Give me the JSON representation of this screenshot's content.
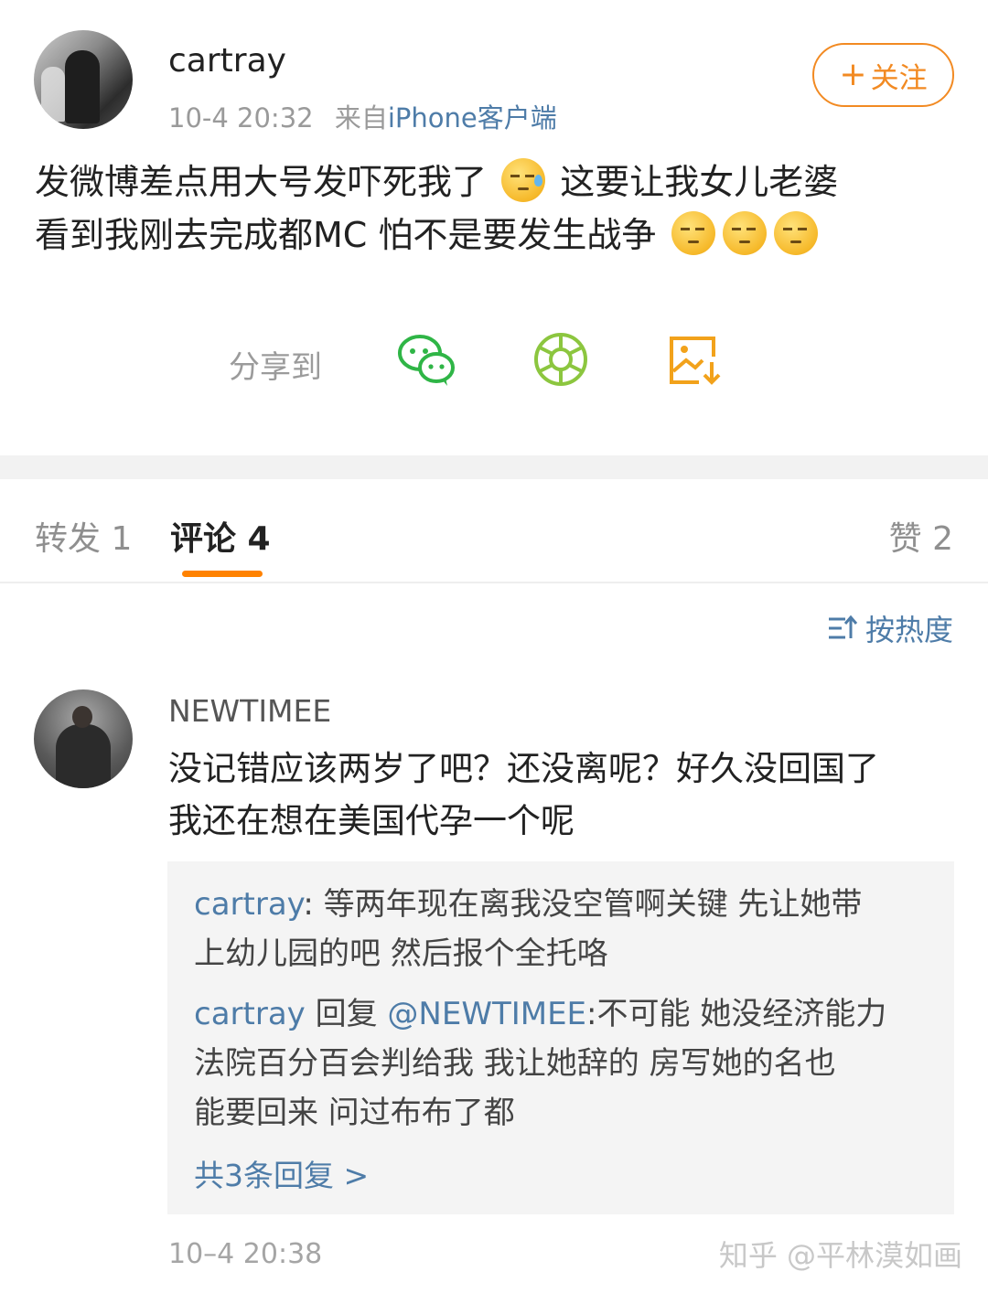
{
  "post": {
    "username": "cartray",
    "time": "10-4 20:32",
    "source_prefix": "来自",
    "source": "iPhone客户端",
    "follow_label": "关注",
    "text_line1_a": "发微博差点用大号发吓死我了",
    "text_line1_b": "这要让我女儿老婆",
    "text_line2": "看到我刚去完成都MC 怕不是要发生战争"
  },
  "share": {
    "label": "分享到",
    "icons": [
      "wechat-icon",
      "moments-icon",
      "save-image-icon"
    ]
  },
  "tabs": {
    "repost": "转发 1",
    "comments": "评论 4",
    "likes": "赞 2",
    "accent_color": "#ff8200"
  },
  "sort": {
    "label": "按热度"
  },
  "comment": {
    "username": "NEWTIMEE",
    "text_line1": "没记错应该两岁了吧？还没离呢？好久没回国了",
    "text_line2": "我还在想在美国代孕一个呢",
    "time": "10–4 20:38"
  },
  "replies": [
    {
      "user": "cartray",
      "separator": ": ",
      "line1": "等两年现在离我没空管啊关键 先让她带",
      "line2": "上幼儿园的吧 然后报个全托咯"
    },
    {
      "user": "cartray",
      "reply_word": " 回复 ",
      "mention": "@NEWTIMEE",
      "line1": ":不可能 她没经济能力",
      "line2": "法院百分百会判给我  我让她辞的 房写她的名也",
      "line3": "能要回来 问过布布了都"
    }
  ],
  "more_replies": "共3条回复 >",
  "watermark": "知乎 @平林漠如画",
  "colors": {
    "link": "#4e7ca8",
    "follow": "#f28a22"
  }
}
